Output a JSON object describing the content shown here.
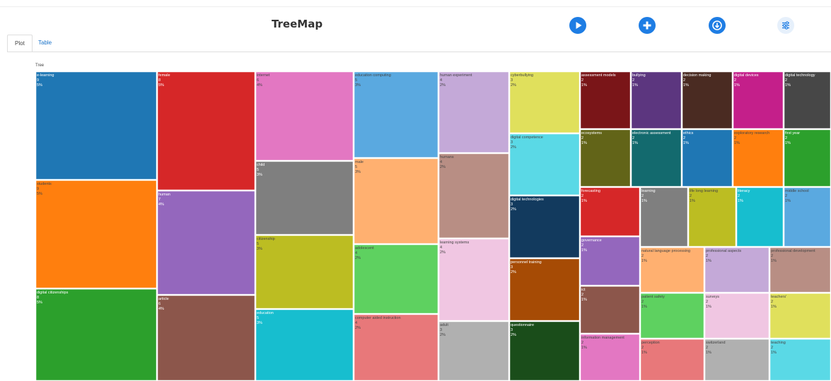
{
  "header": {
    "title": "TreeMap",
    "buttons": [
      {
        "name": "play-icon",
        "style": "blue"
      },
      {
        "name": "plus-icon",
        "style": "blue"
      },
      {
        "name": "download-icon",
        "style": "blue"
      },
      {
        "name": "settings-sliders-icon",
        "style": "light"
      }
    ]
  },
  "tabs": [
    {
      "label": "Plot",
      "active": true
    },
    {
      "label": "Table",
      "active": false
    }
  ],
  "chart_data": {
    "type": "treemap",
    "root_label": "Tree",
    "items": [
      {
        "label": "e-learning",
        "value": 9,
        "percent": "5%",
        "color": "#1f77b4"
      },
      {
        "label": "students",
        "value": 9,
        "percent": "5%",
        "color": "#ff7f0e"
      },
      {
        "label": "digital citizenships",
        "value": 8,
        "percent": "5%",
        "color": "#2ca02c"
      },
      {
        "label": "female",
        "value": 8,
        "percent": "5%",
        "color": "#d62728"
      },
      {
        "label": "human",
        "value": 7,
        "percent": "4%",
        "color": "#9467bd"
      },
      {
        "label": "article",
        "value": 6,
        "percent": "4%",
        "color": "#8c564b"
      },
      {
        "label": "internet",
        "value": 6,
        "percent": "4%",
        "color": "#e377c2"
      },
      {
        "label": "child",
        "value": 5,
        "percent": "3%",
        "color": "#7f7f7f"
      },
      {
        "label": "citizenship",
        "value": 5,
        "percent": "3%",
        "color": "#bcbd22"
      },
      {
        "label": "education",
        "value": 5,
        "percent": "3%",
        "color": "#17becf"
      },
      {
        "label": "education computing",
        "value": 5,
        "percent": "3%",
        "color": "#5aa9e0"
      },
      {
        "label": "male",
        "value": 5,
        "percent": "3%",
        "color": "#ffb070"
      },
      {
        "label": "adolescent",
        "value": 4,
        "percent": "2%",
        "color": "#5ed160"
      },
      {
        "label": "computer aided instruction",
        "value": 4,
        "percent": "2%",
        "color": "#e8787a"
      },
      {
        "label": "human experiment",
        "value": 4,
        "percent": "2%",
        "color": "#c4a9d8"
      },
      {
        "label": "humans",
        "value": 4,
        "percent": "2%",
        "color": "#b88e84"
      },
      {
        "label": "learning systems",
        "value": 4,
        "percent": "2%",
        "color": "#f0c6e2"
      },
      {
        "label": "adult",
        "value": 3,
        "percent": "2%",
        "color": "#b0b0b0"
      },
      {
        "label": "cyberbullying",
        "value": 3,
        "percent": "2%",
        "color": "#e0e05c"
      },
      {
        "label": "digital competence",
        "value": 3,
        "percent": "2%",
        "color": "#5ad9e6"
      },
      {
        "label": "digital technologies",
        "value": 3,
        "percent": "2%",
        "color": "#123a5e"
      },
      {
        "label": "personnel training",
        "value": 3,
        "percent": "2%",
        "color": "#a64b05"
      },
      {
        "label": "questionnaire",
        "value": 3,
        "percent": "2%",
        "color": "#1a4d1a"
      },
      {
        "label": "assessment models",
        "value": 2,
        "percent": "1%",
        "color": "#7a1518"
      },
      {
        "label": "bullying",
        "value": 2,
        "percent": "1%",
        "color": "#5c367f"
      },
      {
        "label": "decision making",
        "value": 2,
        "percent": "1%",
        "color": "#4a2b22"
      },
      {
        "label": "digital devices",
        "value": 2,
        "percent": "1%",
        "color": "#c41f8a"
      },
      {
        "label": "digital technology",
        "value": 2,
        "percent": "1%",
        "color": "#474747"
      },
      {
        "label": "ecosystems",
        "value": 2,
        "percent": "1%",
        "color": "#626418"
      },
      {
        "label": "electronic assessment",
        "value": 2,
        "percent": "1%",
        "color": "#136a6e"
      },
      {
        "label": "ethics",
        "value": 2,
        "percent": "1%",
        "color": "#1f77b4"
      },
      {
        "label": "exploratory research",
        "value": 2,
        "percent": "1%",
        "color": "#ff7f0e"
      },
      {
        "label": "first year",
        "value": 2,
        "percent": "1%",
        "color": "#2ca02c"
      },
      {
        "label": "forecasting",
        "value": 2,
        "percent": "1%",
        "color": "#d62728"
      },
      {
        "label": "governance",
        "value": 2,
        "percent": "1%",
        "color": "#9467bd"
      },
      {
        "label": "ict",
        "value": 2,
        "percent": "1%",
        "color": "#8c564b"
      },
      {
        "label": "information management",
        "value": 2,
        "percent": "1%",
        "color": "#e377c2"
      },
      {
        "label": "learning",
        "value": 2,
        "percent": "1%",
        "color": "#7f7f7f"
      },
      {
        "label": "life long learning",
        "value": 2,
        "percent": "1%",
        "color": "#bcbd22"
      },
      {
        "label": "literacy",
        "value": 2,
        "percent": "1%",
        "color": "#17becf"
      },
      {
        "label": "middle school",
        "value": 2,
        "percent": "1%",
        "color": "#5aa9e0"
      },
      {
        "label": "natural language processing",
        "value": 2,
        "percent": "1%",
        "color": "#ffb070"
      },
      {
        "label": "patient safety",
        "value": 2,
        "percent": "1%",
        "color": "#5ed160"
      },
      {
        "label": "perception",
        "value": 2,
        "percent": "1%",
        "color": "#e8787a"
      },
      {
        "label": "professional aspects",
        "value": 2,
        "percent": "1%",
        "color": "#c4a9d8"
      },
      {
        "label": "professional development",
        "value": 2,
        "percent": "1%",
        "color": "#b88e84"
      },
      {
        "label": "surveys",
        "value": 2,
        "percent": "1%",
        "color": "#f0c6e2"
      },
      {
        "label": "switzerland",
        "value": 2,
        "percent": "1%",
        "color": "#b0b0b0"
      },
      {
        "label": "teachers'",
        "value": 2,
        "percent": "1%",
        "color": "#e0e05c"
      },
      {
        "label": "teaching",
        "value": 2,
        "percent": "1%",
        "color": "#5ad9e6"
      }
    ]
  }
}
